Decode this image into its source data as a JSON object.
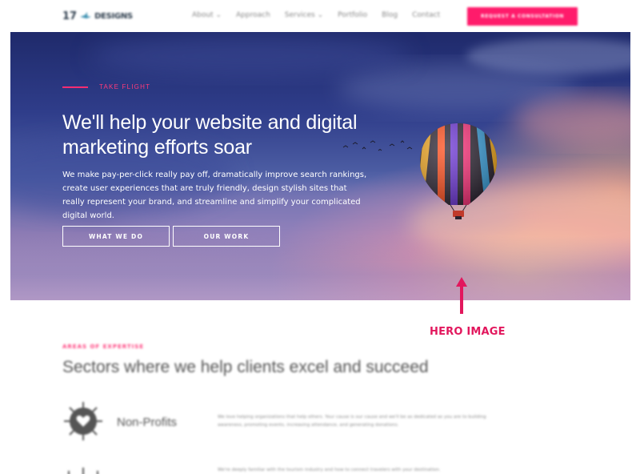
{
  "header": {
    "logo_number": "17",
    "logo_word": "DESIGNS",
    "nav": [
      "About ⌄",
      "Approach",
      "Services ⌄",
      "Portfolio",
      "Blog",
      "Contact"
    ],
    "cta": "REQUEST A CONSULTATION"
  },
  "hero": {
    "eyebrow": "TAKE FLIGHT",
    "headline": "We'll help your website and digital marketing efforts soar",
    "copy": "We make pay-per-click really pay off, dramatically improve search rankings, create user experiences that are truly friendly, design stylish sites that really represent your brand, and streamline and simplify your complicated digital world.",
    "buttons": [
      "WHAT WE DO",
      "OUR WORK"
    ]
  },
  "annotation": {
    "label": "HERO IMAGE",
    "color": "#e2175d"
  },
  "sectors": {
    "eyebrow": "AREAS OF EXPERTISE",
    "title": "Sectors where we help clients excel and succeed",
    "items": [
      {
        "name": "Non-Profits",
        "description": "We love helping organizations that help others. Your cause is our cause and we'll be as dedicated as you are to building awareness, promoting events, increasing attendance, and generating donations."
      },
      {
        "name": "",
        "description": "We're deeply familiar with the tourism industry and how to connect travelers with your destination."
      }
    ]
  },
  "colors": {
    "accent": "#ff1b6b",
    "hero_top": "#1f2a6b",
    "hero_glow": "#ffbe96"
  }
}
